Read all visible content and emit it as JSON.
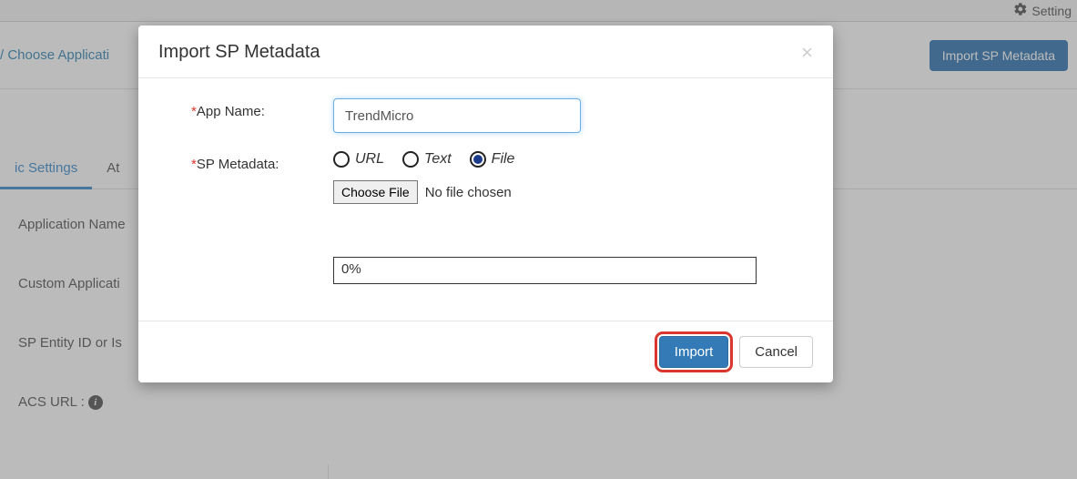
{
  "topbar": {
    "settings_label": "Setting"
  },
  "breadcrumb": {
    "sep": "/",
    "choose_app": "Choose Applicati"
  },
  "header_button": {
    "import_sp_metadata": "Import SP Metadata"
  },
  "tabs": {
    "basic": "ic Settings",
    "attr": "At"
  },
  "bg_labels": {
    "app_name": "Application Name",
    "custom_app": "Custom Applicati",
    "sp_entity": "SP Entity ID or Is",
    "acs_url": "ACS URL :"
  },
  "modal": {
    "title": "Import SP Metadata",
    "app_name_label": "App Name:",
    "app_name_value": "TrendMicro",
    "sp_metadata_label": "SP Metadata:",
    "radio_url": "URL",
    "radio_text": "Text",
    "radio_file": "File",
    "choose_file": "Choose File",
    "no_file": "No file chosen",
    "progress": "0%",
    "import_btn": "Import",
    "cancel_btn": "Cancel"
  }
}
